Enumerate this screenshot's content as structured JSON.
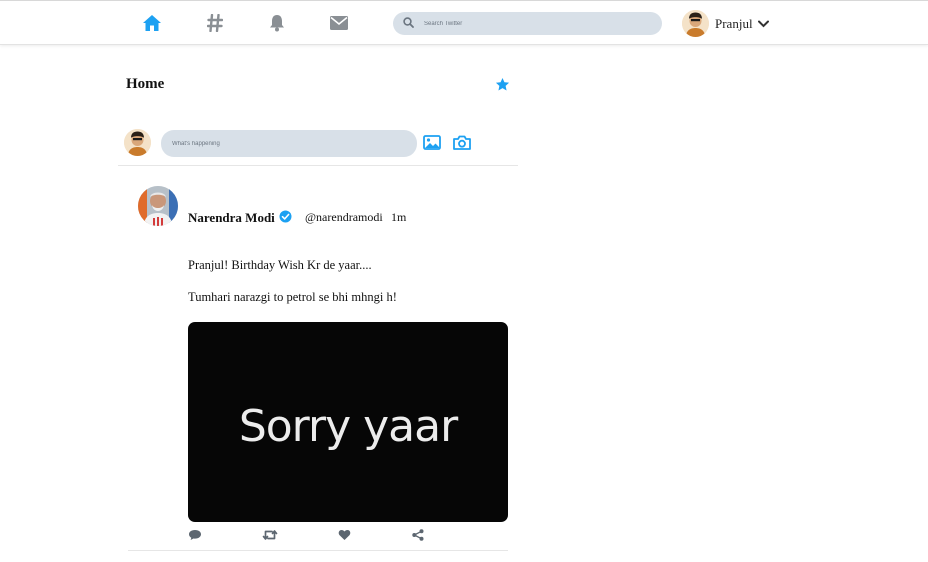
{
  "colors": {
    "accent": "#1da1f2",
    "icon_gray": "#8a8f94",
    "search_bg": "#d8e0e8",
    "media_bg": "#060606"
  },
  "nav": {
    "icons": [
      "home-icon",
      "hashtag-icon",
      "bell-icon",
      "mail-icon"
    ],
    "search_placeholder": "Search Twitter",
    "profile_name": "Pranjul"
  },
  "home": {
    "title": "Home"
  },
  "composer": {
    "placeholder": "What's happening"
  },
  "tweet": {
    "author_name": "Narendra Modi",
    "handle": "@narendramodi",
    "time": "1m",
    "line1": "Pranjul! Birthday Wish Kr de yaar....",
    "line2": "Tumhari narazgi to petrol se bhi mhngi h!",
    "media_text": "Sorry yaar"
  }
}
